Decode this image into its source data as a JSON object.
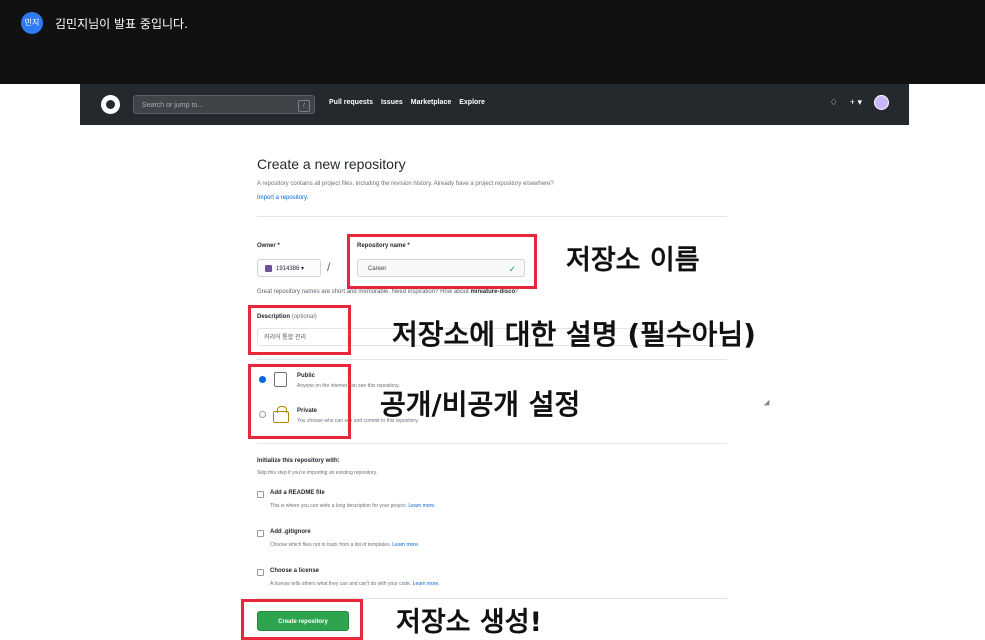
{
  "presenter": {
    "avatar_text": "민지",
    "banner": "김민지님이 발표 중입니다."
  },
  "header": {
    "search_placeholder": "Search or jump to...",
    "search_shortcut": "/",
    "nav": [
      "Pull requests",
      "Issues",
      "Marketplace",
      "Explore"
    ],
    "right_icons": [
      "bell-icon",
      "plus-icon",
      "avatar-icon"
    ]
  },
  "form": {
    "title": "Create a new repository",
    "subtitle": "A repository contains all project files, including the revision history. Already have a project repository elsewhere?",
    "import_link": "Import a repository.",
    "owner_label": "Owner *",
    "owner_value": "1914386 ▾",
    "slash": "/",
    "repo_label": "Repository name *",
    "repo_value": "Career",
    "hint_prefix": "Great repository names are short and memorable. Need inspiration? How about ",
    "hint_suggestion": "miniature-disco",
    "hint_suffix": "?",
    "desc_label": "Description",
    "desc_optional": "(optional)",
    "desc_value": "커리어 통합 관리",
    "public_title": "Public",
    "public_desc": "Anyone on the internet can see this repository.",
    "private_title": "Private",
    "private_desc": "You choose who can see and commit to this repository.",
    "init_title": "Initialize this repository with:",
    "init_sub": "Skip this step if you're importing an existing repository.",
    "readme_label": "Add a README file",
    "readme_desc": "This is where you can write a long description for your project.",
    "gitignore_label": "Add .gitignore",
    "gitignore_desc": "Choose which files not to track from a list of templates.",
    "license_label": "Choose a license",
    "license_desc": "A license tells others what they can and can't do with your code.",
    "learn_more": "Learn more.",
    "create_button": "Create repository"
  },
  "annotations": {
    "repo_name": "저장소 이름",
    "description": "저장소에 대한 설명 (필수아님)",
    "visibility": "공개/비공개 설정",
    "create": "저장소 생성!"
  },
  "colors": {
    "annotation_box": "#e8283a",
    "create_button": "#2ea44f",
    "header_bg": "#24292e"
  }
}
